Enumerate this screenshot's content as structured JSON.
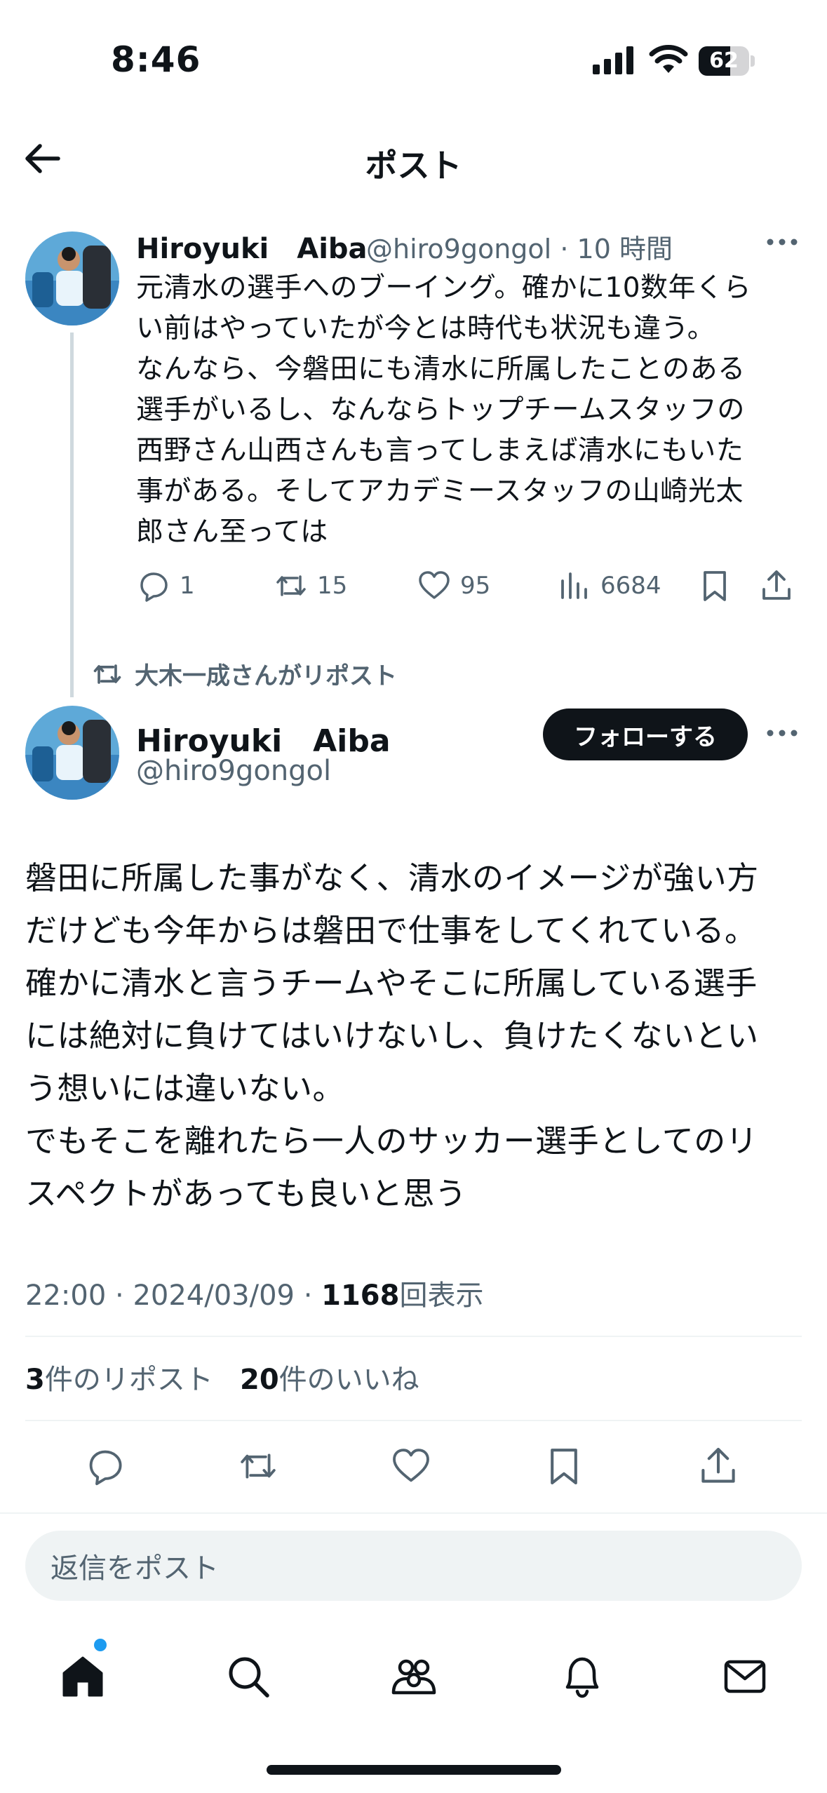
{
  "status_bar": {
    "time": "8:46",
    "battery": "62",
    "battery_level": 0.62
  },
  "header": {
    "title": "ポスト",
    "back_icon": "arrow-left-icon"
  },
  "parent_post": {
    "name": "Hiroyuki　Aiba",
    "handle": "@hiro9gongol",
    "separator": "·",
    "time": "10 時間",
    "text": "元清水の選手へのブーイング。確かに10数年くら\nい前はやっていたが今とは時代も状況も違う。\nなんなら、今磐田にも清水に所属したことのある\n選手がいるし、なんならトップチームスタッフの\n西野さん山西さんも言ってしまえば清水にもいた\n事がある。そしてアカデミースタッフの山崎光太\n郎さん至っては",
    "replies": "1",
    "reposts": "15",
    "likes": "95",
    "views": "6684"
  },
  "repost_context": {
    "text": "大木一成さんがリポスト"
  },
  "main_post": {
    "name": "Hiroyuki　Aiba",
    "handle": "@hiro9gongol",
    "follow_label": "フォローする",
    "text": "磐田に所属した事がなく、清水のイメージが強い方\nだけども今年からは磐田で仕事をしてくれている。\n確かに清水と言うチームやそこに所属している選手\nには絶対に負けてはいけないし、負けたくないとい\nう想いには違いない。\nでもそこを離れたら一人のサッカー選手としてのリ\nスペクトがあっても良いと思う",
    "time": "22:00",
    "date": "2024/03/09",
    "sep": "·",
    "view_count": "1168",
    "view_label": "回表示",
    "repost_count": "3",
    "repost_label": "件のリポスト",
    "like_count": "20",
    "like_label": "件のいいね"
  },
  "reply": {
    "placeholder": "返信をポスト"
  },
  "nav": {
    "items": [
      "home-icon",
      "search-icon",
      "communities-icon",
      "notifications-icon",
      "messages-icon"
    ]
  },
  "colors": {
    "text": "#0f1419",
    "secondary": "#536471",
    "accent": "#1d9bf0",
    "divider": "#eff3f4"
  }
}
